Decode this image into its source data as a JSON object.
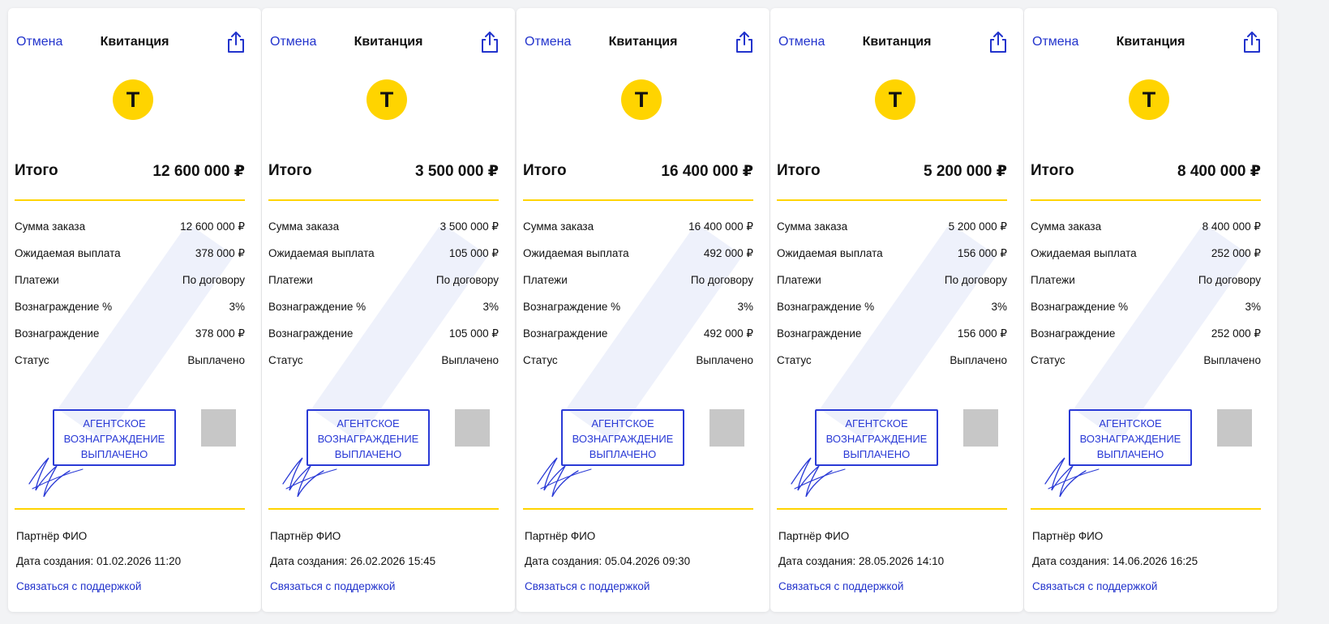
{
  "cards": [
    {
      "header": {
        "cancel": "Отмена",
        "title": "Квитанция"
      },
      "logo": "Т",
      "total": {
        "label": "Итого",
        "value": "12 600 000 ₽"
      },
      "rows": [
        {
          "label": "Сумма заказа",
          "value": "12 600 000 ₽"
        },
        {
          "label": "Ожидаемая выплата",
          "value": "378 000 ₽"
        },
        {
          "label": "Платежи",
          "value": "По договору"
        },
        {
          "label": "Вознаграждение %",
          "value": "3%"
        },
        {
          "label": "Вознаграждение",
          "value": "378 000 ₽"
        },
        {
          "label": "Статус",
          "value": "Выплачено"
        }
      ],
      "stamp": [
        "АГЕНТСКОЕ",
        "ВОЗНАГРАЖДЕНИЕ",
        "ВЫПЛАЧЕНО"
      ],
      "footer": {
        "partner": "Партнёр ФИО",
        "created": "Дата создания: 01.02.2026 11:20",
        "support": "Связаться с поддержкой"
      }
    },
    {
      "header": {
        "cancel": "Отмена",
        "title": "Квитанция"
      },
      "logo": "Т",
      "total": {
        "label": "Итого",
        "value": "3 500 000 ₽"
      },
      "rows": [
        {
          "label": "Сумма заказа",
          "value": "3 500 000 ₽"
        },
        {
          "label": "Ожидаемая выплата",
          "value": "105 000 ₽"
        },
        {
          "label": "Платежи",
          "value": "По договору"
        },
        {
          "label": "Вознаграждение %",
          "value": "3%"
        },
        {
          "label": "Вознаграждение",
          "value": "105 000 ₽"
        },
        {
          "label": "Статус",
          "value": "Выплачено"
        }
      ],
      "stamp": [
        "АГЕНТСКОЕ",
        "ВОЗНАГРАЖДЕНИЕ",
        "ВЫПЛАЧЕНО"
      ],
      "footer": {
        "partner": "Партнёр ФИО",
        "created": "Дата создания: 26.02.2026 15:45",
        "support": "Связаться с поддержкой"
      }
    },
    {
      "header": {
        "cancel": "Отмена",
        "title": "Квитанция"
      },
      "logo": "Т",
      "total": {
        "label": "Итого",
        "value": "16 400 000 ₽"
      },
      "rows": [
        {
          "label": "Сумма заказа",
          "value": "16 400 000 ₽"
        },
        {
          "label": "Ожидаемая выплата",
          "value": "492 000 ₽"
        },
        {
          "label": "Платежи",
          "value": "По договору"
        },
        {
          "label": "Вознаграждение %",
          "value": "3%"
        },
        {
          "label": "Вознаграждение",
          "value": "492 000 ₽"
        },
        {
          "label": "Статус",
          "value": "Выплачено"
        }
      ],
      "stamp": [
        "АГЕНТСКОЕ",
        "ВОЗНАГРАЖДЕНИЕ",
        "ВЫПЛАЧЕНО"
      ],
      "footer": {
        "partner": "Партнёр ФИО",
        "created": "Дата создания: 05.04.2026 09:30",
        "support": "Связаться с поддержкой"
      }
    },
    {
      "header": {
        "cancel": "Отмена",
        "title": "Квитанция"
      },
      "logo": "Т",
      "total": {
        "label": "Итого",
        "value": "5 200 000 ₽"
      },
      "rows": [
        {
          "label": "Сумма заказа",
          "value": "5 200 000 ₽"
        },
        {
          "label": "Ожидаемая выплата",
          "value": "156 000 ₽"
        },
        {
          "label": "Платежи",
          "value": "По договору"
        },
        {
          "label": "Вознаграждение %",
          "value": "3%"
        },
        {
          "label": "Вознаграждение",
          "value": "156 000 ₽"
        },
        {
          "label": "Статус",
          "value": "Выплачено"
        }
      ],
      "stamp": [
        "АГЕНТСКОЕ",
        "ВОЗНАГРАЖДЕНИЕ",
        "ВЫПЛАЧЕНО"
      ],
      "footer": {
        "partner": "Партнёр ФИО",
        "created": "Дата создания: 28.05.2026 14:10",
        "support": "Связаться с поддержкой"
      }
    },
    {
      "header": {
        "cancel": "Отмена",
        "title": "Квитанция"
      },
      "logo": "Т",
      "total": {
        "label": "Итого",
        "value": "8 400 000 ₽"
      },
      "rows": [
        {
          "label": "Сумма заказа",
          "value": "8 400 000 ₽"
        },
        {
          "label": "Ожидаемая выплата",
          "value": "252 000 ₽"
        },
        {
          "label": "Платежи",
          "value": "По договору"
        },
        {
          "label": "Вознаграждение %",
          "value": "3%"
        },
        {
          "label": "Вознаграждение",
          "value": "252 000 ₽"
        },
        {
          "label": "Статус",
          "value": "Выплачено"
        }
      ],
      "stamp": [
        "АГЕНТСКОЕ",
        "ВОЗНАГРАЖДЕНИЕ",
        "ВЫПЛАЧЕНО"
      ],
      "footer": {
        "partner": "Партнёр ФИО",
        "created": "Дата создания: 14.06.2026 16:25",
        "support": "Связаться с поддержкой"
      }
    }
  ],
  "icons": {
    "share": "share-icon",
    "qr": "qr-code-icon"
  },
  "colors": {
    "accent_yellow": "#ffd400",
    "link_blue": "#2233cc",
    "stamp_blue": "#2a3ad6",
    "qr_gray": "#c7c7c7"
  }
}
